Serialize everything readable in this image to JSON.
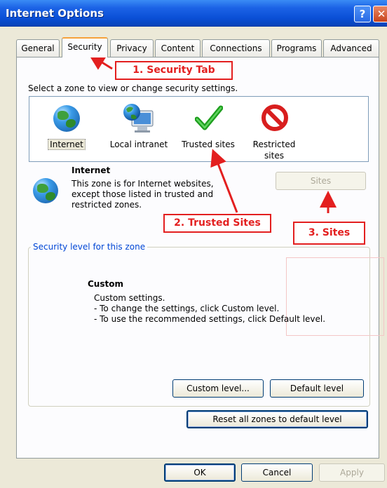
{
  "window": {
    "title": "Internet Options",
    "help_glyph": "?",
    "close_glyph": "✕"
  },
  "tabs": [
    {
      "label": "General"
    },
    {
      "label": "Security",
      "active": true
    },
    {
      "label": "Privacy"
    },
    {
      "label": "Content"
    },
    {
      "label": "Connections"
    },
    {
      "label": "Programs"
    },
    {
      "label": "Advanced"
    }
  ],
  "security": {
    "zone_prompt": "Select a zone to view or change security settings.",
    "zones": [
      {
        "label": "Internet",
        "icon": "globe-icon",
        "selected": true
      },
      {
        "label": "Local intranet",
        "icon": "computer-globe-icon"
      },
      {
        "label": "Trusted sites",
        "icon": "checkmark-icon"
      },
      {
        "label": "Restricted sites",
        "label_line1": "Restricted",
        "label_line2": "sites",
        "icon": "no-entry-icon"
      }
    ],
    "selected_zone_title": "Internet",
    "selected_zone_desc": "This zone is for Internet websites, except those listed in trusted and restricted zones.",
    "sites_button": "Sites",
    "level_group_label": "Security level for this zone",
    "level_title": "Custom",
    "level_lines": [
      "Custom settings.",
      "- To change the settings, click Custom level.",
      "- To use the recommended settings, click Default level."
    ],
    "custom_level_button": "Custom level...",
    "default_level_button": "Default level",
    "reset_button": "Reset all zones to default level"
  },
  "footer": {
    "ok": "OK",
    "cancel": "Cancel",
    "apply": "Apply"
  },
  "annotations": {
    "security_tab": "1.  Security Tab",
    "trusted_sites": "2.  Trusted Sites",
    "sites": "3.  Sites"
  },
  "colors": {
    "titlebar": "#0a4fd6",
    "annotation_red": "#e31f1f",
    "group_label_blue": "#0046d5",
    "tab_highlight": "#f6a23b"
  }
}
